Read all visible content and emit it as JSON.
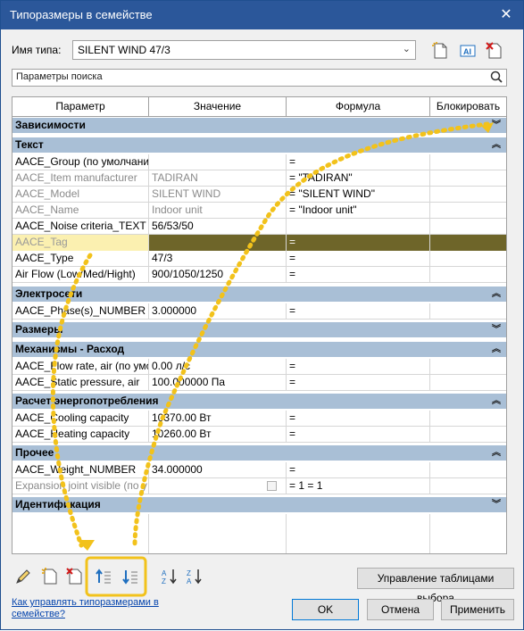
{
  "window": {
    "title": "Типоразмеры в семействе"
  },
  "type_name": {
    "label": "Имя типа:",
    "value": "SILENT WIND 47/3"
  },
  "search": {
    "placeholder": "Параметры поиска"
  },
  "columns": [
    "Параметр",
    "Значение",
    "Формула",
    "Блокировать"
  ],
  "groups": {
    "deps": "Зависимости",
    "text": "Текст",
    "electrical": "Электросети",
    "dimensions": "Размеры",
    "mechanical_flow": "Механизмы - Расход",
    "energy": "Расчет энергопотребления",
    "other": "Прочее",
    "identity": "Идентификация"
  },
  "rows": {
    "group": [
      "AACE_Group (по умолчани",
      "",
      "="
    ],
    "manufacturer": [
      "AACE_Item manufacturer",
      "TADIRAN",
      "= \"TADIRAN\""
    ],
    "model": [
      "AACE_Model",
      "SILENT WIND",
      "= \"SILENT WIND\""
    ],
    "name": [
      "AACE_Name",
      "Indoor unit",
      "= \"Indoor unit\""
    ],
    "noise": [
      "AACE_Noise criteria_TEXT",
      "56/53/50",
      ""
    ],
    "tag": [
      "AACE_Tag",
      "",
      "="
    ],
    "type": [
      "AACE_Type",
      "47/3",
      "="
    ],
    "airflow": [
      "Air Flow (Low/Med/Hight)",
      "900/1050/1250",
      "="
    ],
    "phases": [
      "AACE_Phase(s)_NUMBER",
      "3.000000",
      "="
    ],
    "flowrate": [
      "AACE_Flow rate, air (по умо",
      "0.00 л/с",
      "="
    ],
    "static": [
      "AACE_Static pressure, air",
      "100.000000 Па",
      "="
    ],
    "cooling": [
      "AACE_Cooling capacity",
      "10370.00 Вт",
      "="
    ],
    "heating": [
      "AACE_Heating capacity",
      "10260.00 Вт",
      "="
    ],
    "weight": [
      "AACE_Weight_NUMBER",
      "34.000000",
      "="
    ],
    "expansion": [
      "Expansion joint visible (по у",
      "",
      "= 1 = 1"
    ]
  },
  "buttons": {
    "manage_lookup": "Управление таблицами выбора",
    "ok": "OK",
    "cancel": "Отмена",
    "apply": "Применить"
  },
  "help_link": "Как управлять типоразмерами в семействе?",
  "colors": {
    "titlebar": "#2b579a",
    "group_header": "#a9bfd6",
    "selected_row": "#6e6529",
    "highlight": "#f2c21b"
  }
}
